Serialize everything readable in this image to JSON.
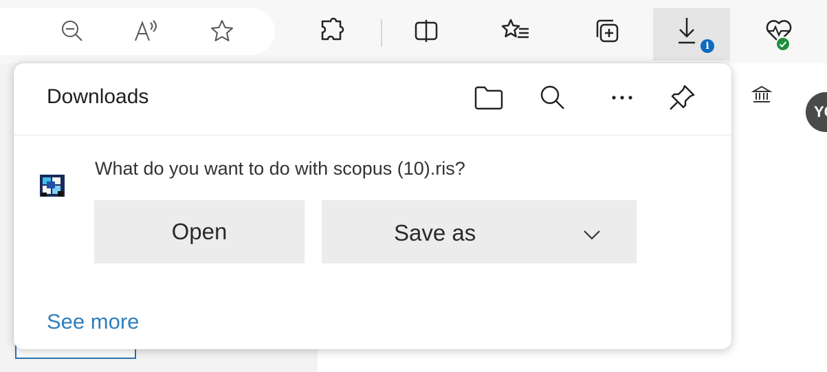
{
  "toolbar": {
    "icons": [
      "zoom-out-icon",
      "read-aloud-icon",
      "favorite-star-icon",
      "extensions-icon",
      "split-screen-icon",
      "favorites-icon",
      "collections-icon",
      "downloads-icon",
      "browser-essentials-icon"
    ],
    "downloads_badge": "i"
  },
  "page": {
    "avatar_text": "YC"
  },
  "downloads_panel": {
    "title": "Downloads",
    "header_actions": [
      "open-downloads-folder",
      "search-downloads",
      "more-options",
      "pin-downloads"
    ],
    "prompt": "What do you want to do with scopus (10).ris?",
    "open_label": "Open",
    "save_as_label": "Save as",
    "see_more_label": "See more"
  },
  "colors": {
    "link": "#2f7fbd",
    "info_badge": "#0f6cbd",
    "health_badge": "#1e8e3e",
    "button_bg": "#ececec"
  }
}
